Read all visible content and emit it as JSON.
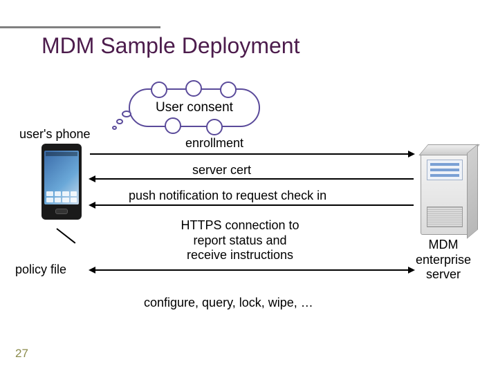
{
  "title": "MDM Sample Deployment",
  "cloud_label": "User consent",
  "phone_label": "user's phone",
  "policy_label": "policy file",
  "server_label": "MDM\nenterprise\nserver",
  "flow": {
    "enrollment": "enrollment",
    "server_cert": "server cert",
    "push": "push notification to request check in",
    "https": "HTTPS connection to\nreport status and\nreceive instructions",
    "ops": "configure,  query,  lock,  wipe, …"
  },
  "page_number": "27"
}
